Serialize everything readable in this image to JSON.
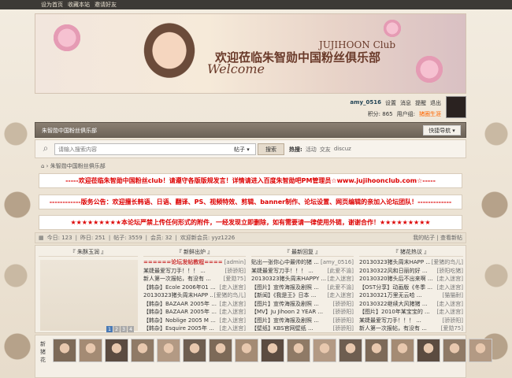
{
  "topbar": {
    "links": [
      "设为首页",
      "收藏本站",
      "邀请好友"
    ]
  },
  "banner": {
    "title": "欢迎莅临朱智勋中国粉丝俱乐部",
    "welcome": "Welcome",
    "club": "JUJIHOON Club"
  },
  "user": {
    "name": "amy_0516",
    "links": [
      "设置",
      "消息",
      "提醒",
      "退出"
    ],
    "points_label": "积分: 865",
    "group_label": "用户组:",
    "group": "猪圈生涯"
  },
  "nav": {
    "home": "朱智勋中国粉丝俱乐部",
    "quick_nav": "快捷导航"
  },
  "search": {
    "placeholder": "请输入搜索内容",
    "type": "帖子",
    "button": "搜索",
    "hot_label": "热搜:",
    "hot_items": [
      "活动",
      "交友",
      "discuz"
    ]
  },
  "breadcrumb": "朱智勋中国粉丝俱乐部",
  "notices": [
    "-----欢迎莅临朱智勋中国粉丝club！请遵守各版版规发言！详情请进入百度朱智勋吧PM管理员☆www.jujihoonclub.com☆-----",
    "------------版务公告：欢迎擅长韩语、日语、翻译、PS、视频特效、剪辑、banner制作、论坛设置、网页编辑的亲加入论坛团队！-------------",
    "★★★★★★★★★本论坛严禁上传任何形式的附件，一经发现立即删除，如有需要请一律使用外链，谢谢合作！★★★★★★★★★"
  ],
  "stats": {
    "today": "今日: 123",
    "yesterday": "昨日: 251",
    "posts": "帖子: 3559",
    "members": "会员: 32",
    "newest": "欢迎新会员: yyz1226",
    "right": "我的帖子 | 查看新帖"
  },
  "columns": [
    {
      "header": "『 朱酥玉润 』",
      "items": []
    },
    {
      "header": "『 新鲜出炉 』",
      "items": [
        {
          "t": "======论坛发帖教程====",
          "a": "[admin]",
          "hl": true
        },
        {
          "t": "某婕最爱写刀手！！！ ...",
          "a": "[骄骄阳]"
        },
        {
          "t": "新人第一次报帖，有没有 ...",
          "a": "[爱勋75]"
        },
        {
          "t": "【韩杂】Ecole 2006年01 ...",
          "a": "[走入迷宫]"
        },
        {
          "t": "20130323猪头周末HAPP ...",
          "a": "[爱猪的鸟儿]"
        },
        {
          "t": "【韩杂】BAZAAR 2005年 ...",
          "a": "[走入迷宫]"
        },
        {
          "t": "【韩杂】BAZAAR 2005年 ...",
          "a": "[走入迷宫]"
        },
        {
          "t": "【韩杂】Noblige 2005 M ...",
          "a": "[走入迷宫]"
        },
        {
          "t": "【韩杂】Esquire 2005年 ...",
          "a": "[走入迷宫]"
        }
      ]
    },
    {
      "header": "『 最新回复 』",
      "items": [
        {
          "t": "贴出一张你心中最帅的猪 ...",
          "a": "[amy_0516]"
        },
        {
          "t": "某婕最爱写刀手！！！ ...",
          "a": "[此爱不渝]"
        },
        {
          "t": "20130323猪头周末HAPPY ...",
          "a": "[走入迷宫]"
        },
        {
          "t": "【图片】宣传海报及剧照 ...",
          "a": "[此爱不渝]"
        },
        {
          "t": "【新闻】《我是王》日本 ...",
          "a": "[走入迷宫]"
        },
        {
          "t": "【图片】宣传海报及剧照 ...",
          "a": "[骄骄阳]"
        },
        {
          "t": "【MV】Ju Jihoon 2 YEAR ...",
          "a": "[骄骄阳]"
        },
        {
          "t": "【图片】宣传海报及剧照 ...",
          "a": "[骄骄阳]"
        },
        {
          "t": "【壁纸】KBS官网壁纸 ...",
          "a": "[骄骄阳]"
        }
      ]
    },
    {
      "header": "『 猪花热议 』",
      "items": [
        {
          "t": "20130323猪头周末HAPP ...",
          "a": "[爱猪的鸟儿]"
        },
        {
          "t": "20130322风和日丽的好 ...",
          "a": "[骄阳吃猪]"
        },
        {
          "t": "20130320猪头后不出来啊 ...",
          "a": "[走入迷宫]"
        },
        {
          "t": "【OST分享】动画版《冬季 ...",
          "a": "[走入迷宫]"
        },
        {
          "t": "20130321万里无云哈 ...",
          "a": "[猫猫耐]"
        },
        {
          "t": "20130322继续大风猪猪 ...",
          "a": "[走入迷宫]"
        },
        {
          "t": "【图片】2010年某宝宝的 ...",
          "a": "[走入迷宫]"
        },
        {
          "t": "某婕最爱写刀手！！！ ...",
          "a": "[骄骄阳]"
        },
        {
          "t": "新人第一次报帖，有没有 ...",
          "a": "[爱勋75]"
        }
      ]
    }
  ],
  "pager": [
    "1",
    "2",
    "3",
    "4"
  ],
  "faces_label": "新猪花",
  "face_count": 17
}
